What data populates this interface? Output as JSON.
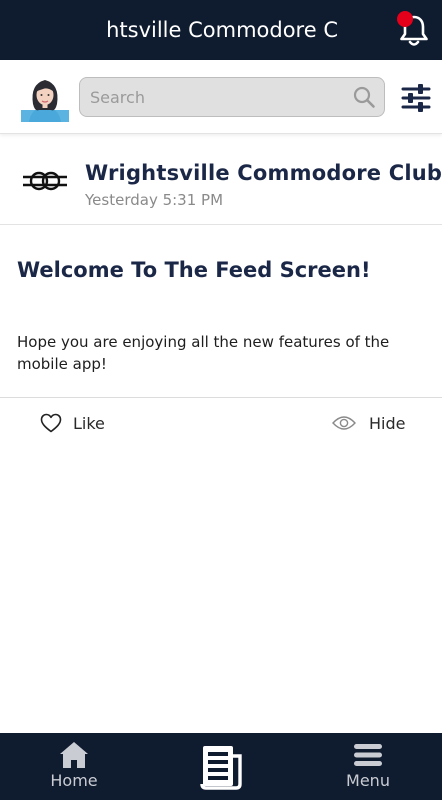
{
  "header": {
    "title": "ghtsville Commodore C",
    "notification_color": "#e4001b"
  },
  "search": {
    "placeholder": "Search"
  },
  "post": {
    "author": "Wrightsville Commodore Club",
    "timestamp": "Yesterday 5:31 PM",
    "title": "Welcome To The Feed Screen!",
    "body": "Hope you are enjoying all the new features of the mobile app!",
    "actions": {
      "like_label": "Like",
      "hide_label": "Hide"
    }
  },
  "bottom_nav": {
    "home_label": "Home",
    "feed_icon": "newspaper-icon",
    "menu_label": "Menu"
  },
  "colors": {
    "bar_background": "#0f1b2e",
    "accent_text": "#1b2746"
  }
}
